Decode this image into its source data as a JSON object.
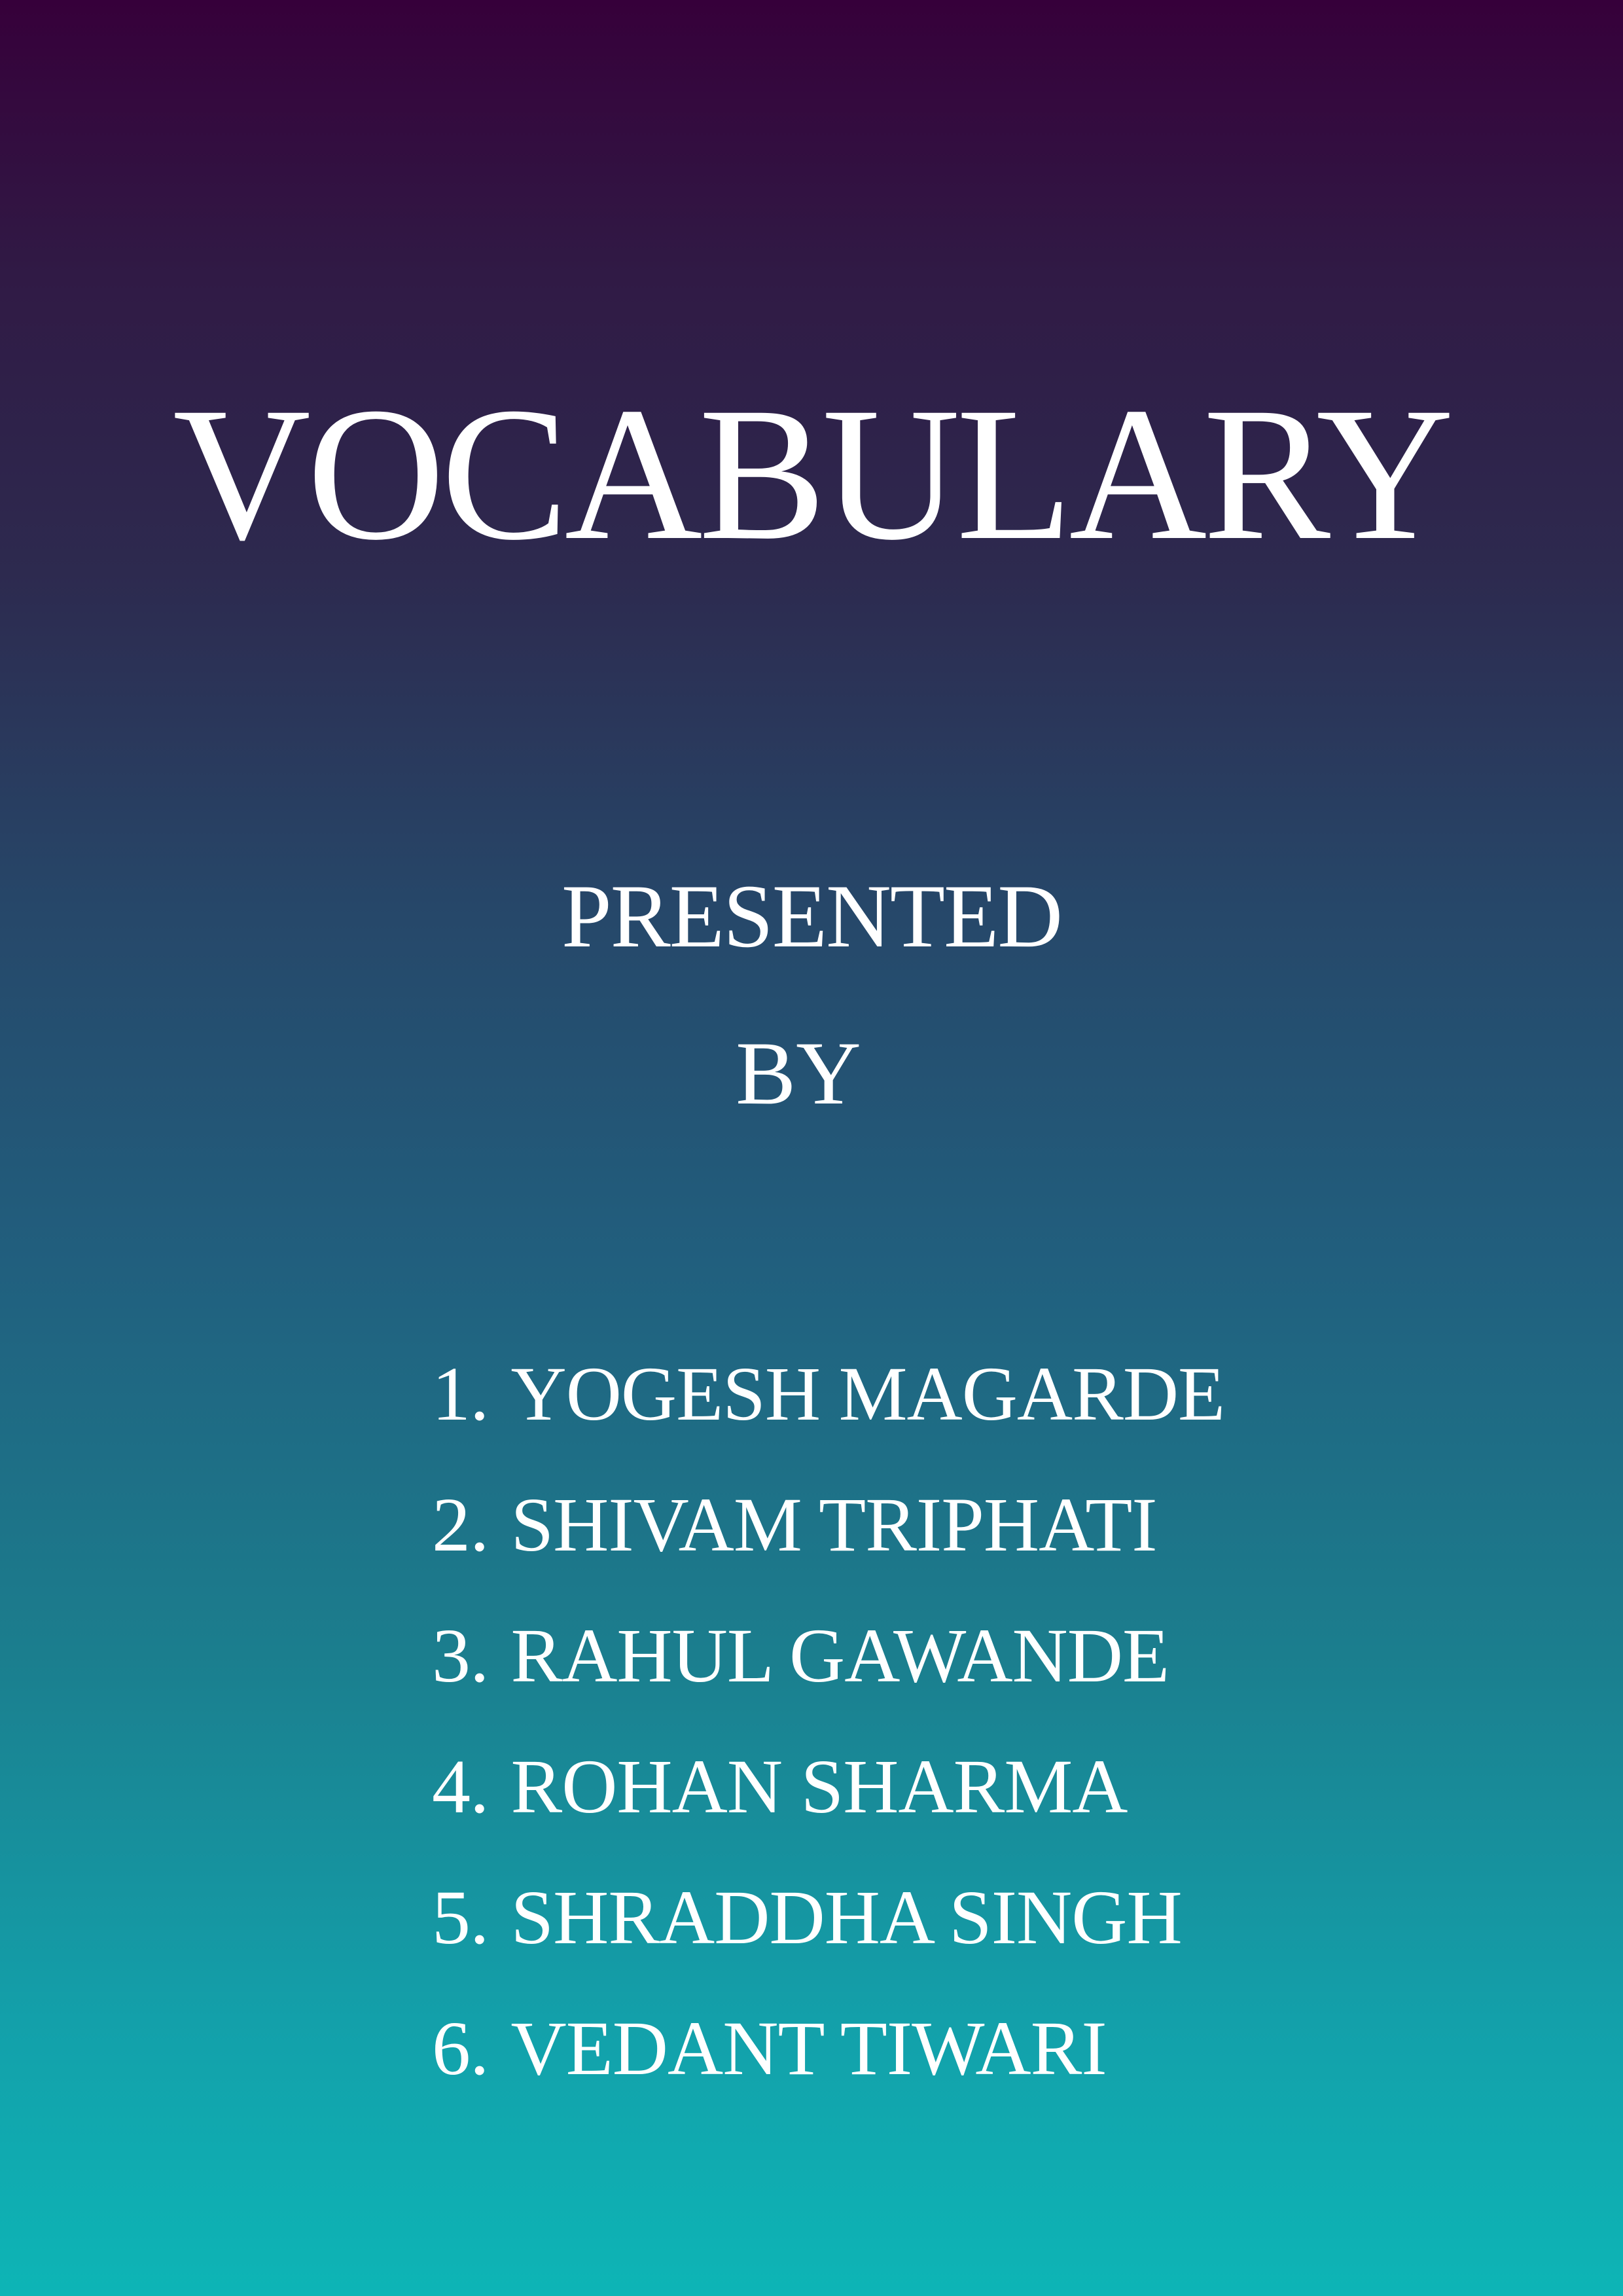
{
  "title": "VOCABULARY",
  "presented_line1": "PRESENTED",
  "presented_line2": "BY",
  "members": [
    {
      "number": "1.",
      "name": "YOGESH MAGARDE"
    },
    {
      "number": "2.",
      "name": "SHIVAM TRIPHATI"
    },
    {
      "number": "3.",
      "name": "RAHUL GAWANDE"
    },
    {
      "number": "4.",
      "name": "ROHAN SHARMA"
    },
    {
      "number": "5.",
      "name": "SHRADDHA SINGH"
    },
    {
      "number": "6.",
      "name": "VEDANT TIWARI"
    }
  ],
  "colors": {
    "gradient_top": "#36003a",
    "gradient_bottom": "#0db5b6",
    "text": "#ffffff"
  }
}
